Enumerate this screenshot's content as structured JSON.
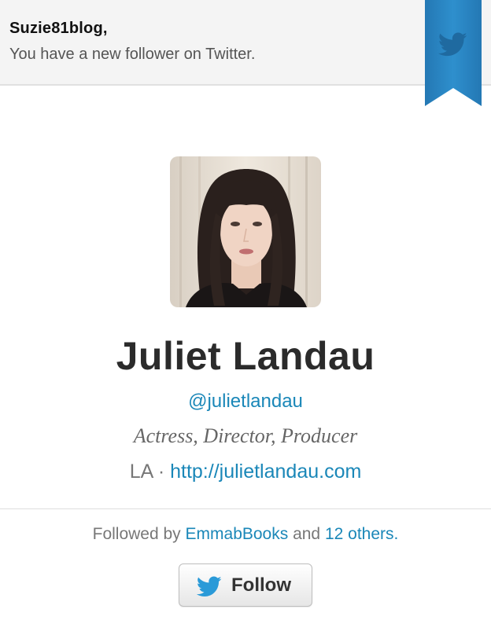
{
  "header": {
    "recipient": "Suzie81blog,",
    "message": "You have a new follower on Twitter."
  },
  "ribbon": {
    "icon": "twitter-bird-icon",
    "color": "#2a8ac6"
  },
  "profile": {
    "name": "Juliet Landau",
    "handle": "@julietlandau",
    "bio": "Actress, Director, Producer",
    "location": "LA",
    "separator": " · ",
    "website": "http://julietlandau.com"
  },
  "followed_by": {
    "prefix": "Followed by ",
    "user": "EmmabBooks",
    "middle": " and ",
    "others": "12 others",
    "suffix": "."
  },
  "follow_button": {
    "label": "Follow",
    "icon": "twitter-bird-icon"
  },
  "colors": {
    "link": "#1a87b8",
    "ribbon": "#2a8ac6"
  }
}
